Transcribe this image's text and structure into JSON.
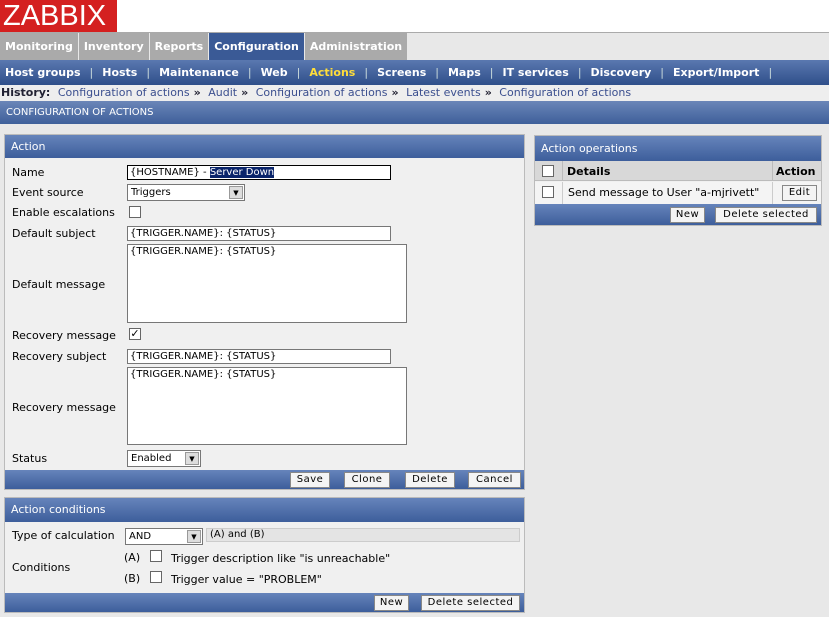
{
  "logo": "ZABBIX",
  "main_tabs": [
    {
      "label": "Monitoring"
    },
    {
      "label": "Inventory"
    },
    {
      "label": "Reports"
    },
    {
      "label": "Configuration"
    },
    {
      "label": "Administration"
    }
  ],
  "sub_nav": [
    {
      "label": "Host groups"
    },
    {
      "label": "Hosts"
    },
    {
      "label": "Maintenance"
    },
    {
      "label": "Web"
    },
    {
      "label": "Actions"
    },
    {
      "label": "Screens"
    },
    {
      "label": "Maps"
    },
    {
      "label": "IT services"
    },
    {
      "label": "Discovery"
    },
    {
      "label": "Export/Import"
    }
  ],
  "history": {
    "label": "History:",
    "items": [
      "Configuration of actions",
      "Audit",
      "Configuration of actions",
      "Latest events",
      "Configuration of actions"
    ]
  },
  "page_title": "CONFIGURATION OF ACTIONS",
  "action": {
    "title": "Action",
    "name_label": "Name",
    "name_prefix": "{HOSTNAME} - ",
    "name_selected": "Server Down",
    "event_source_label": "Event source",
    "event_source": "Triggers",
    "escalations_label": "Enable escalations",
    "default_subject_label": "Default subject",
    "default_subject": "{TRIGGER.NAME}: {STATUS}",
    "default_message_label": "Default message",
    "default_message": "{TRIGGER.NAME}: {STATUS}",
    "recovery_label": "Recovery message",
    "recovery_subject_label": "Recovery subject",
    "recovery_subject": "{TRIGGER.NAME}: {STATUS}",
    "recovery_message_label": "Recovery message",
    "recovery_message": "{TRIGGER.NAME}: {STATUS}",
    "status_label": "Status",
    "status": "Enabled",
    "buttons": {
      "save": "Save",
      "clone": "Clone",
      "delete": "Delete",
      "cancel": "Cancel"
    }
  },
  "conditions": {
    "title": "Action conditions",
    "calc_label": "Type of calculation",
    "calc": "AND",
    "formula": "(A) and (B)",
    "conditions_label": "Conditions",
    "items": [
      {
        "id": "(A)",
        "text": "Trigger description like \"is unreachable\""
      },
      {
        "id": "(B)",
        "text": "Trigger value = \"PROBLEM\""
      }
    ],
    "new": "New",
    "delete_selected": "Delete selected"
  },
  "operations": {
    "title": "Action operations",
    "col_details": "Details",
    "col_action": "Action",
    "rows": [
      {
        "details": "Send message to User \"a-mjrivett\"",
        "action": "Edit"
      }
    ],
    "new": "New",
    "delete_selected": "Delete selected"
  }
}
